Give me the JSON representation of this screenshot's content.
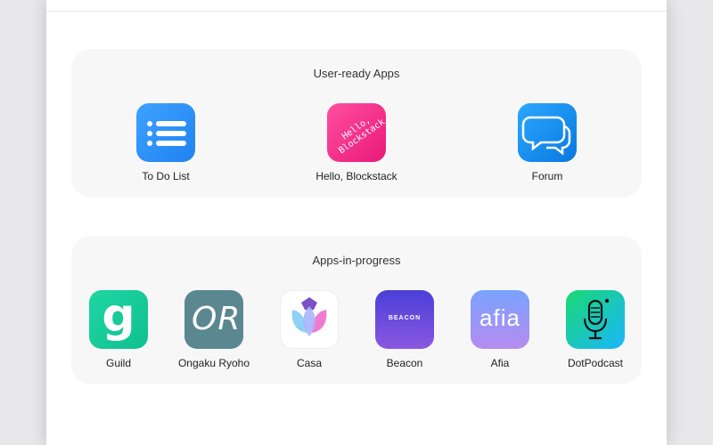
{
  "sections": {
    "ready": {
      "title": "User-ready Apps",
      "apps": [
        {
          "label": "To Do List",
          "icon": "todo-list-icon"
        },
        {
          "label": "Hello, Blockstack",
          "icon": "hello-blockstack-icon",
          "icon_text": "Hello, Blockstack"
        },
        {
          "label": "Forum",
          "icon": "forum-icon"
        }
      ]
    },
    "progress": {
      "title": "Apps-in-progress",
      "apps": [
        {
          "label": "Guild",
          "icon": "guild-icon",
          "icon_text": "g"
        },
        {
          "label": "Ongaku Ryoho",
          "icon": "ongaku-ryoho-icon",
          "icon_text": "OR"
        },
        {
          "label": "Casa",
          "icon": "casa-tulip-icon"
        },
        {
          "label": "Beacon",
          "icon": "beacon-icon",
          "icon_text": "BEACON"
        },
        {
          "label": "Afia",
          "icon": "afia-icon",
          "icon_text": "afia"
        },
        {
          "label": "DotPodcast",
          "icon": "microphone-icon"
        }
      ]
    }
  },
  "colors": {
    "section_bg": "#f7f7f8",
    "todo": "#2a90f5",
    "hello": "#f0288a",
    "forum": "#1a8ff0",
    "guild": "#16cc9a",
    "ongaku": "#5b8791",
    "beacon": "#6a4cdc",
    "afia": "#9a96f5",
    "dotpodcast": "#19c9a0"
  }
}
